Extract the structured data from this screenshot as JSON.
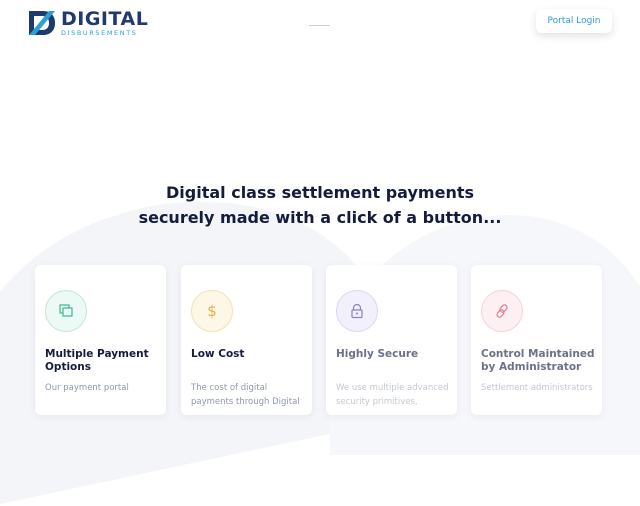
{
  "header": {
    "logo_title": "DIGITAL",
    "logo_subtitle": "DISBURSEMENTS",
    "portal_login": "Portal Login"
  },
  "hero": {
    "line1": "Digital class settlement payments",
    "line2": "securely made with a click of a button..."
  },
  "features": [
    {
      "title": "Multiple Payment Options",
      "text": "Our payment portal",
      "icon": "payment-options-icon",
      "icon_color": "#3cb88a",
      "icon_bg": "#edf9f4"
    },
    {
      "title": "Low Cost",
      "text": "The cost of digital payments through Digital",
      "icon": "dollar-icon",
      "icon_color": "#e5b23e",
      "icon_bg": "#fdf7e8"
    },
    {
      "title": "Highly Secure",
      "text": "We use multiple advanced security primitives,",
      "icon": "lock-icon",
      "icon_color": "#8a7fd0",
      "icon_bg": "#f2f0fb"
    },
    {
      "title": "Control Maintained by Administrator",
      "text": "Settlement administrators",
      "icon": "link-icon",
      "icon_color": "#e37c8e",
      "icon_bg": "#fdf0f2"
    }
  ],
  "colors": {
    "brand_navy": "#1f3a6e",
    "brand_blue": "#2a9fd6",
    "heading": "#141b3c"
  }
}
